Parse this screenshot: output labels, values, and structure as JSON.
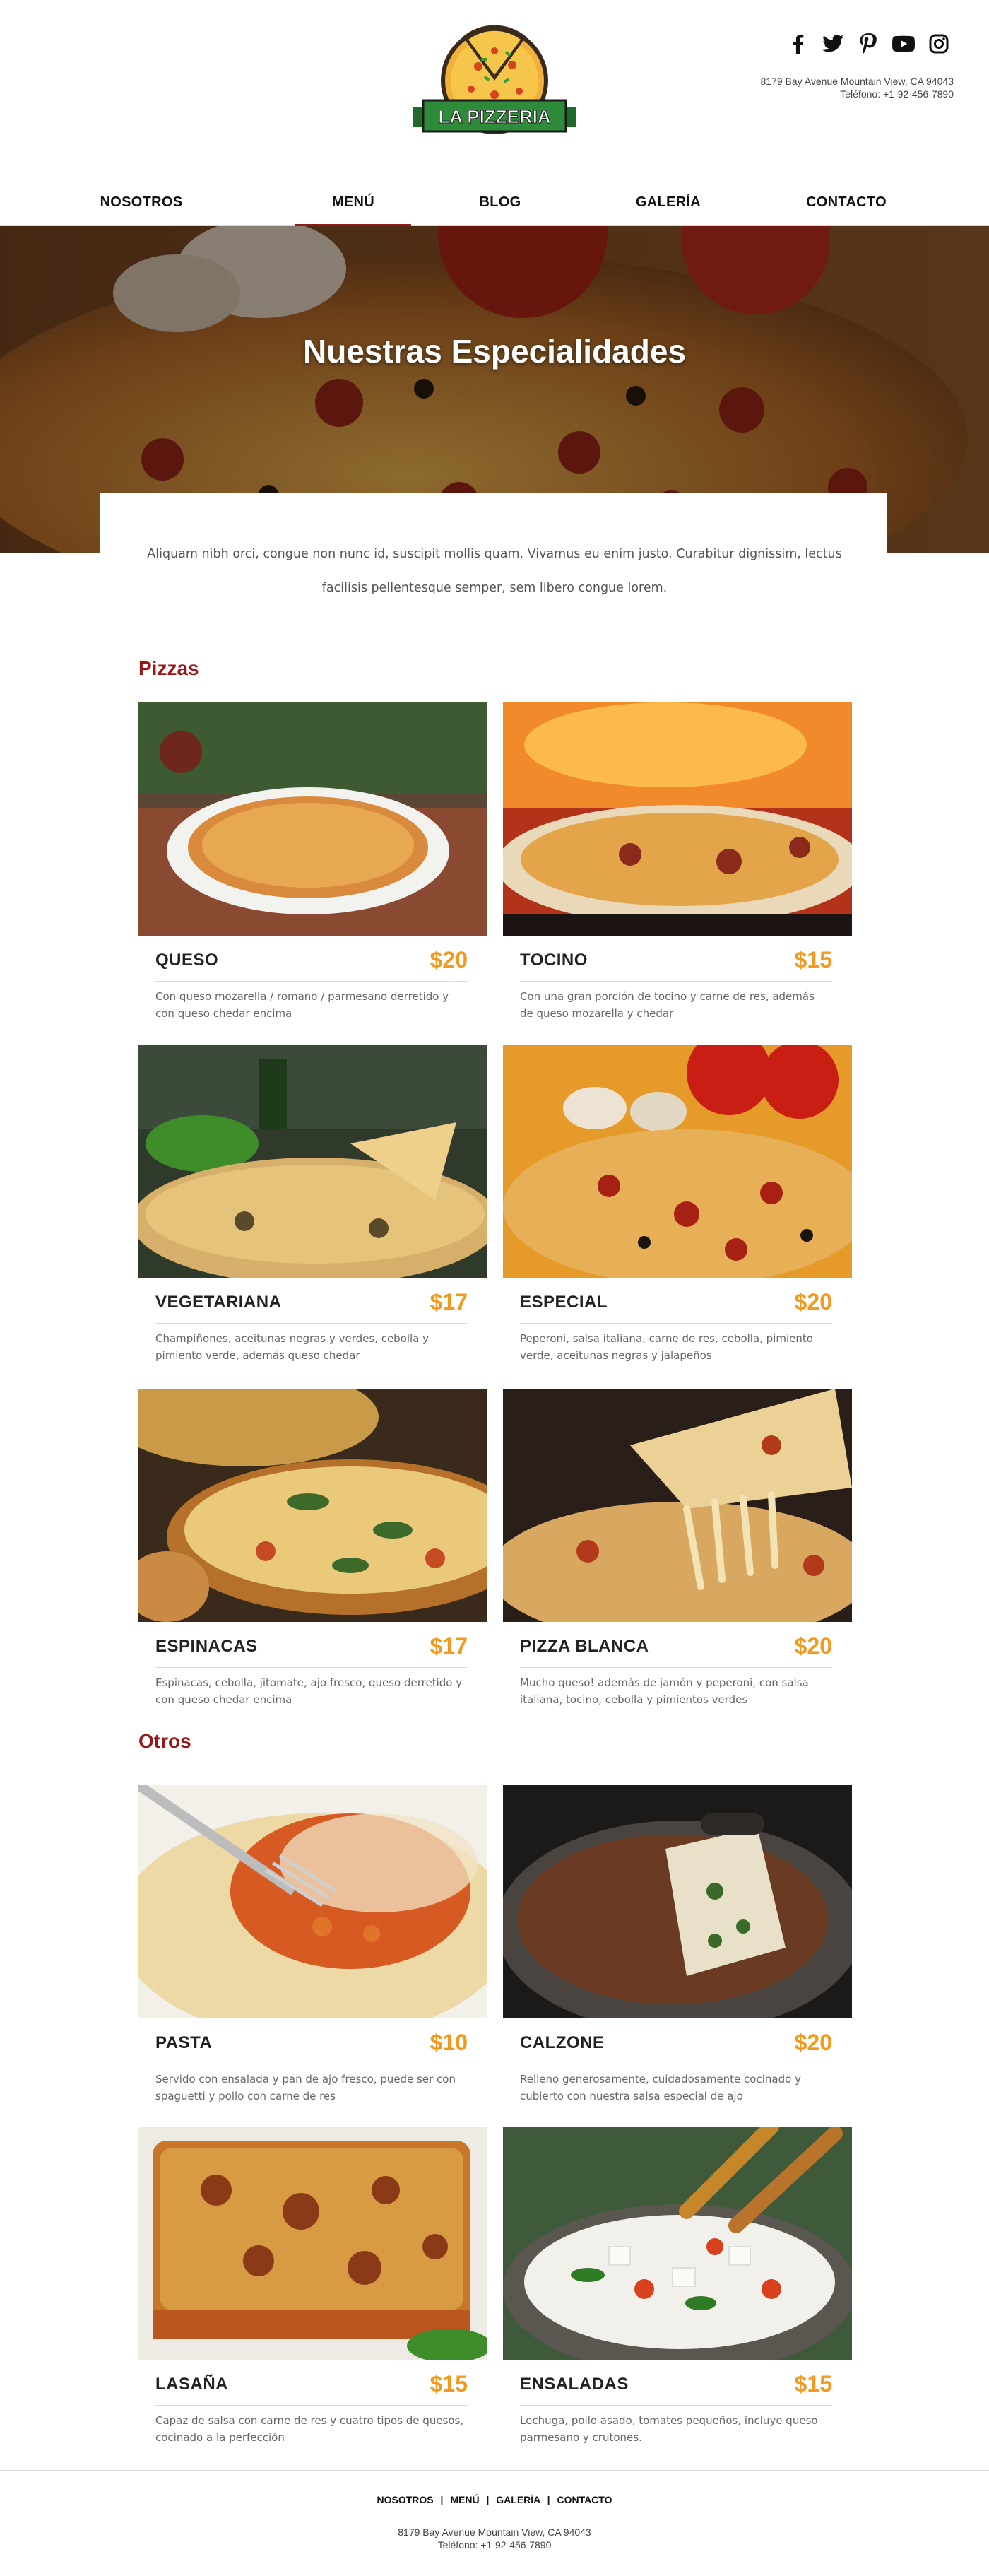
{
  "brand": {
    "logo_text": "LA PIZZERIA",
    "colors": {
      "primary_red": "#9a1515",
      "accent_orange": "#f39a1d",
      "logo_green": "#2e8b3a"
    }
  },
  "header": {
    "social_icons": [
      "facebook-icon",
      "twitter-icon",
      "pinterest-icon",
      "youtube-icon",
      "instagram-icon"
    ],
    "address_line1": "8179 Bay Avenue  Mountain View, CA 94043",
    "address_line2": "Teléfono: +1-92-456-7890"
  },
  "nav": {
    "items": [
      {
        "label": "NOSOTROS"
      },
      {
        "label": "MENÚ",
        "active": true
      },
      {
        "label": "BLOG"
      },
      {
        "label": "GALERÍA"
      },
      {
        "label": "CONTACTO"
      }
    ]
  },
  "hero": {
    "title": "Nuestras Especialidades",
    "intro": "Aliquam nibh orci, congue non nunc id, suscipit mollis quam. Vivamus eu enim justo. Curabitur dignissim, lectus facilisis pellentesque semper, sem libero congue lorem."
  },
  "pizzas": {
    "title": "Pizzas",
    "items": [
      {
        "name": "QUESO",
        "price": "$20",
        "desc": "Con queso mozarella / romano / parmesano derretido y con queso chedar encima"
      },
      {
        "name": "TOCINO",
        "price": "$15",
        "desc": "Con una gran porción de tocino y carne de res, además de queso mozarella y chedar"
      },
      {
        "name": "VEGETARIANA",
        "price": "$17",
        "desc": "Champiñones, aceitunas negras y verdes, cebolla y pimiento verde, además queso chedar"
      },
      {
        "name": "ESPECIAL",
        "price": "$20",
        "desc": "Peperoni, salsa italiana, carne de res, cebolla, pimiento verde, aceitunas negras y jalapeños"
      },
      {
        "name": "ESPINACAS",
        "price": "$17",
        "desc": "Espinacas, cebolla, jitomate, ajo fresco, queso derretido y con queso chedar encima"
      },
      {
        "name": "PIZZA BLANCA",
        "price": "$20",
        "desc": "Mucho queso! además de jamón y peperoni, con salsa italiana, tocino, cebolla y pimientos verdes"
      }
    ]
  },
  "otros": {
    "title": "Otros",
    "items": [
      {
        "name": "PASTA",
        "price": "$10",
        "desc": "Servido con ensalada y pan de ajo fresco, puede ser con spaguetti y pollo con carne de res"
      },
      {
        "name": "CALZONE",
        "price": "$20",
        "desc": "Relleno generosamente, cuidadosamente cocinado y cubierto con nuestra salsa especial de ajo"
      },
      {
        "name": "LASAÑA",
        "price": "$15",
        "desc": "Capaz de salsa con carne de res y cuatro tipos de quesos, cocinado a la perfección"
      },
      {
        "name": "ENSALADAS",
        "price": "$15",
        "desc": "Lechuga, pollo asado, tomates pequeños, incluye queso parmesano y crutones."
      }
    ]
  },
  "footer": {
    "links": [
      "NOSOTROS",
      "MENÚ",
      "GALERÍA",
      "CONTACTO"
    ],
    "separator": "|",
    "address_line1": "8179 Bay Avenue  Mountain View, CA 94043",
    "address_line2": "Teléfono: +1-92-456-7890"
  }
}
